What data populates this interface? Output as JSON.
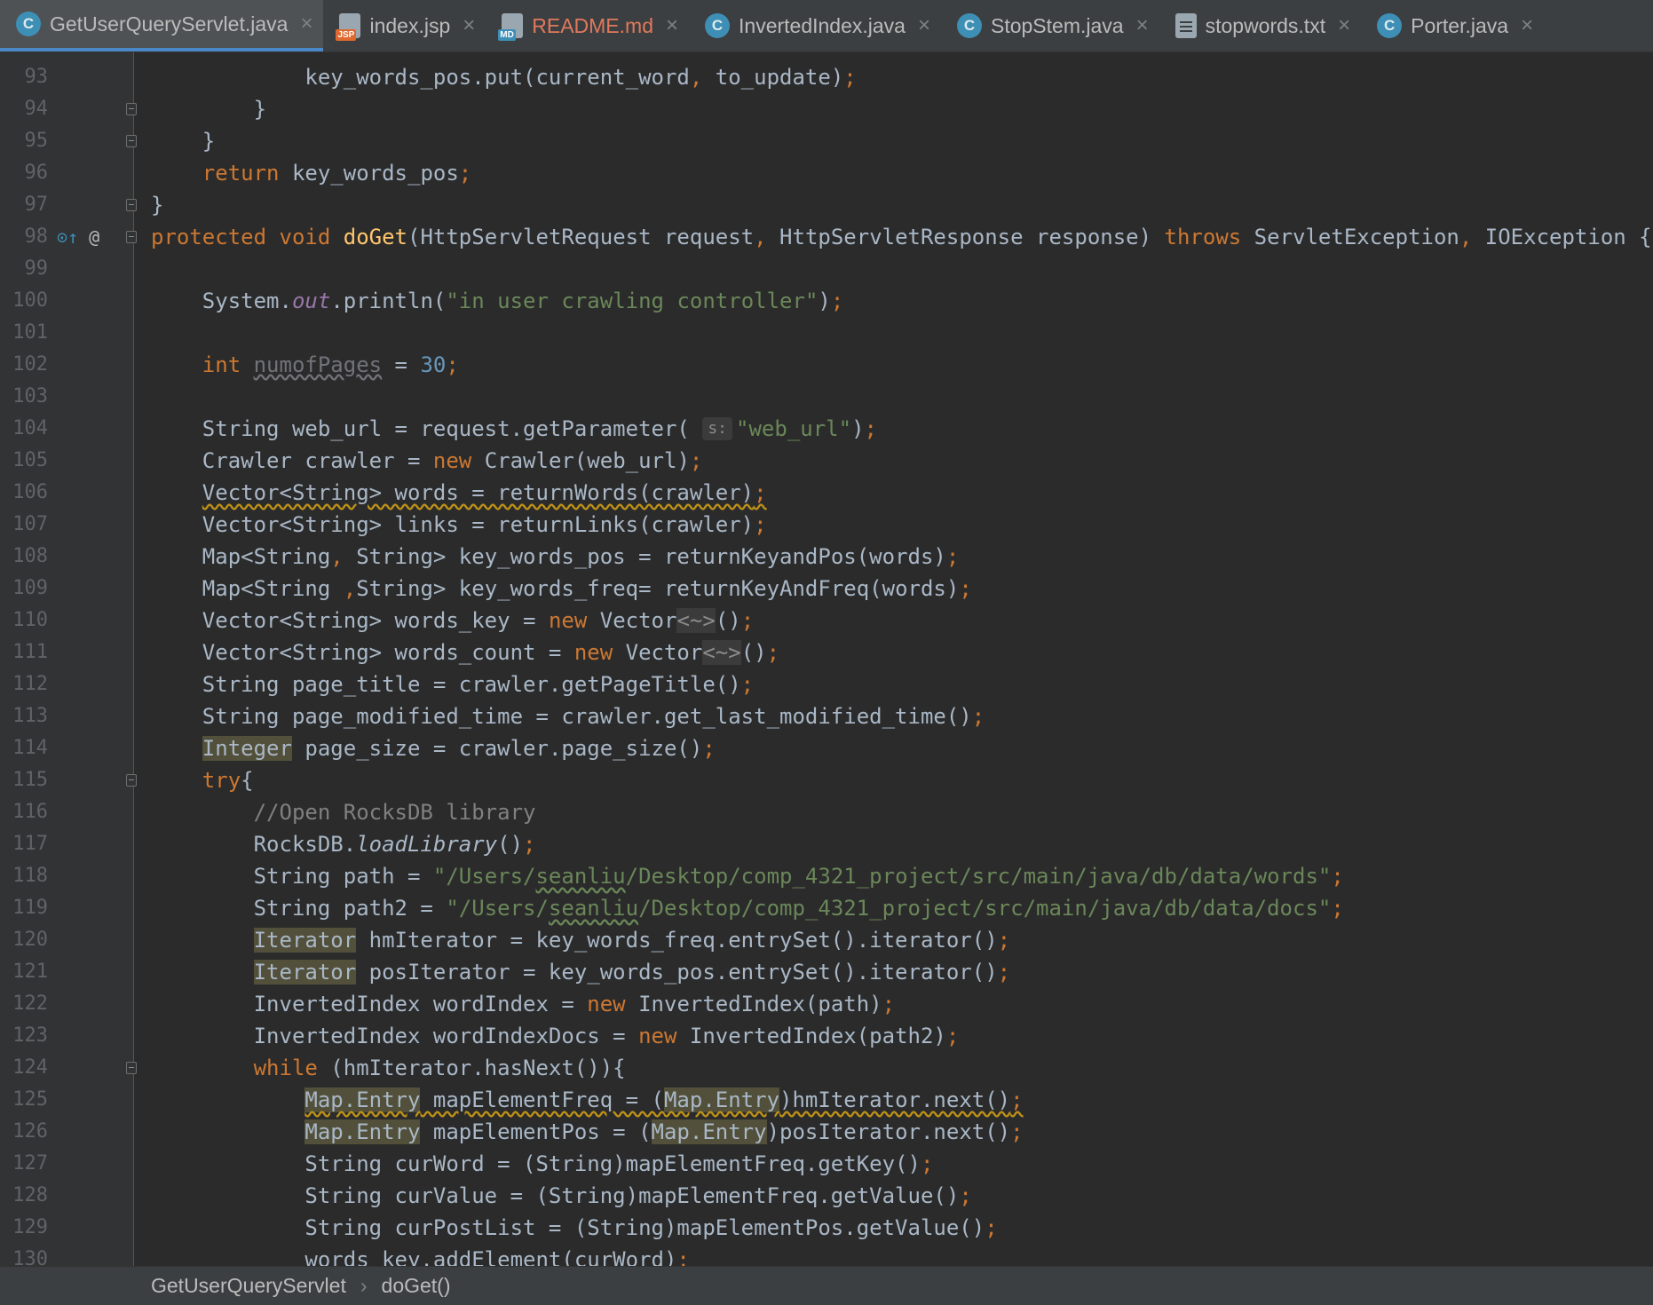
{
  "tabs": [
    {
      "label": "GetUserQueryServlet.java",
      "icon": "java-class-icon",
      "active": true
    },
    {
      "label": "index.jsp",
      "icon": "jsp-file-icon"
    },
    {
      "label": "README.md",
      "icon": "markdown-file-icon",
      "modified": true
    },
    {
      "label": "InvertedIndex.java",
      "icon": "java-class-icon"
    },
    {
      "label": "StopStem.java",
      "icon": "java-class-icon"
    },
    {
      "label": "stopwords.txt",
      "icon": "text-file-icon"
    },
    {
      "label": "Porter.java",
      "icon": "java-class-icon"
    }
  ],
  "tab_close_glyph": "×",
  "jsp_badge": "JSP",
  "md_badge": "MD",
  "class_badge": "C",
  "gutter_icons": {
    "override": "⊙↑",
    "annotation": "@"
  },
  "editor": {
    "lines": [
      {
        "n": "93",
        "text": "            key_words_pos.put(current_word, to_update);"
      },
      {
        "n": "94",
        "text": "        }"
      },
      {
        "n": "95",
        "text": "    }"
      },
      {
        "n": "96",
        "text": "    return key_words_pos;"
      },
      {
        "n": "97",
        "text": "}"
      },
      {
        "n": "98",
        "text": "protected void doGet(HttpServletRequest request, HttpServletResponse response) throws ServletException, IOException {"
      },
      {
        "n": "99",
        "text": ""
      },
      {
        "n": "100",
        "text": "    System.out.println(\"in user crawling controller\");"
      },
      {
        "n": "101",
        "text": ""
      },
      {
        "n": "102",
        "text": "    int numofPages = 30;"
      },
      {
        "n": "103",
        "text": ""
      },
      {
        "n": "104",
        "text": "    String web_url = request.getParameter( s: \"web_url\");"
      },
      {
        "n": "105",
        "text": "    Crawler crawler = new Crawler(web_url);"
      },
      {
        "n": "106",
        "text": "    Vector<String> words = returnWords(crawler);"
      },
      {
        "n": "107",
        "text": "    Vector<String> links = returnLinks(crawler);"
      },
      {
        "n": "108",
        "text": "    Map<String, String> key_words_pos = returnKeyandPos(words);"
      },
      {
        "n": "109",
        "text": "    Map<String ,String> key_words_freq= returnKeyAndFreq(words);"
      },
      {
        "n": "110",
        "text": "    Vector<String> words_key = new Vector<~>();"
      },
      {
        "n": "111",
        "text": "    Vector<String> words_count = new Vector<~>();"
      },
      {
        "n": "112",
        "text": "    String page_title = crawler.getPageTitle();"
      },
      {
        "n": "113",
        "text": "    String page_modified_time = crawler.get_last_modified_time();"
      },
      {
        "n": "114",
        "text": "    Integer page_size = crawler.page_size();"
      },
      {
        "n": "115",
        "text": "    try{"
      },
      {
        "n": "116",
        "text": "        //Open RocksDB library"
      },
      {
        "n": "117",
        "text": "        RocksDB.loadLibrary();"
      },
      {
        "n": "118",
        "text": "        String path = \"/Users/seanliu/Desktop/comp_4321_project/src/main/java/db/data/words\";"
      },
      {
        "n": "119",
        "text": "        String path2 = \"/Users/seanliu/Desktop/comp_4321_project/src/main/java/db/data/docs\";"
      },
      {
        "n": "120",
        "text": "        Iterator hmIterator = key_words_freq.entrySet().iterator();"
      },
      {
        "n": "121",
        "text": "        Iterator posIterator = key_words_pos.entrySet().iterator();"
      },
      {
        "n": "122",
        "text": "        InvertedIndex wordIndex = new InvertedIndex(path);"
      },
      {
        "n": "123",
        "text": "        InvertedIndex wordIndexDocs = new InvertedIndex(path2);"
      },
      {
        "n": "124",
        "text": "        while (hmIterator.hasNext()){"
      },
      {
        "n": "125",
        "text": "            Map.Entry mapElementFreq = (Map.Entry)hmIterator.next();"
      },
      {
        "n": "126",
        "text": "            Map.Entry mapElementPos = (Map.Entry)posIterator.next();"
      },
      {
        "n": "127",
        "text": "            String curWord = (String)mapElementFreq.getKey();"
      },
      {
        "n": "128",
        "text": "            String curValue = (String)mapElementFreq.getValue();"
      },
      {
        "n": "129",
        "text": "            String curPostList = (String)mapElementPos.getValue();"
      },
      {
        "n": "130",
        "text": "            words_key.addElement(curWord);"
      }
    ]
  },
  "breadcrumb": {
    "class_name": "GetUserQueryServlet",
    "separator": "›",
    "method": "doGet()"
  }
}
